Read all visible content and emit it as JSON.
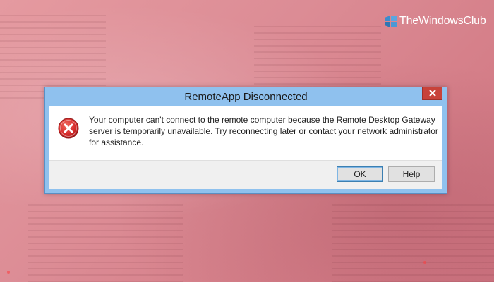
{
  "watermark": {
    "site_name": "TheWindowsClub",
    "logo_icon": "windows-club-logo-icon",
    "logo_color": "#3c8ccd"
  },
  "dialog": {
    "title": "RemoteApp Disconnected",
    "close_icon": "close-icon",
    "close_color": "#c8423a",
    "frame_color": "#8fc1ee",
    "error_icon": "error-x-icon",
    "error_color": "#d52b2b",
    "message": "Your computer can't connect to the remote computer because the Remote Desktop Gateway server is temporarily unavailable. Try reconnecting later or contact your network administrator for assistance.",
    "buttons": {
      "ok_label": "OK",
      "help_label": "Help"
    }
  }
}
